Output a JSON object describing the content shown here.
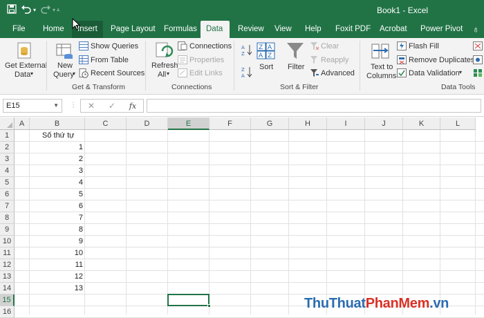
{
  "window": {
    "title": "Book1  -  Excel"
  },
  "qat": {
    "save_icon": "save-icon",
    "undo_icon": "undo-icon",
    "redo_icon": "redo-icon"
  },
  "tabs": [
    {
      "label": "File"
    },
    {
      "label": "Home"
    },
    {
      "label": "Insert"
    },
    {
      "label": "Page Layout"
    },
    {
      "label": "Formulas"
    },
    {
      "label": "Data"
    },
    {
      "label": "Review"
    },
    {
      "label": "View"
    },
    {
      "label": "Help"
    },
    {
      "label": "Foxit PDF"
    },
    {
      "label": "Acrobat"
    },
    {
      "label": "Power Pivot"
    }
  ],
  "active_tab": "Data",
  "ribbon": {
    "get_external_data": {
      "line1": "Get External",
      "line2": "Data"
    },
    "new_query": {
      "line1": "New",
      "line2": "Query"
    },
    "show_queries": "Show Queries",
    "from_table": "From Table",
    "recent_sources": "Recent Sources",
    "group_get_transform": "Get & Transform",
    "refresh_all": {
      "line1": "Refresh",
      "line2": "All"
    },
    "connections": "Connections",
    "properties": "Properties",
    "edit_links": "Edit Links",
    "group_connections": "Connections",
    "sort": "Sort",
    "filter": "Filter",
    "clear": "Clear",
    "reapply": "Reapply",
    "advanced": "Advanced",
    "group_sort_filter": "Sort & Filter",
    "text_to_columns": {
      "line1": "Text to",
      "line2": "Columns"
    },
    "flash_fill": "Flash Fill",
    "remove_duplicates": "Remove Duplicates",
    "data_validation": "Data Validation",
    "group_data_tools": "Data Tools"
  },
  "formula_bar": {
    "name_box": "E15",
    "formula": ""
  },
  "columns": [
    "A",
    "B",
    "C",
    "D",
    "E",
    "F",
    "G",
    "H",
    "I",
    "J",
    "K",
    "L"
  ],
  "rows": [
    "1",
    "2",
    "3",
    "4",
    "5",
    "6",
    "7",
    "8",
    "9",
    "10",
    "11",
    "12",
    "13",
    "14",
    "15",
    "16"
  ],
  "cells": {
    "B1": "Số thứ tự",
    "B2": "1",
    "B3": "2",
    "B4": "3",
    "B5": "4",
    "B6": "5",
    "B7": "6",
    "B8": "7",
    "B9": "8",
    "B10": "9",
    "B11": "10",
    "B12": "11",
    "B13": "12",
    "B14": "13"
  },
  "selected_cell": "E15",
  "watermark": {
    "part1": "ThuThuat",
    "part2": "PhanMem",
    "part3": ".vn"
  },
  "colors": {
    "accent": "#217346",
    "wm_blue": "#2b6cb0",
    "wm_red": "#d93025"
  }
}
